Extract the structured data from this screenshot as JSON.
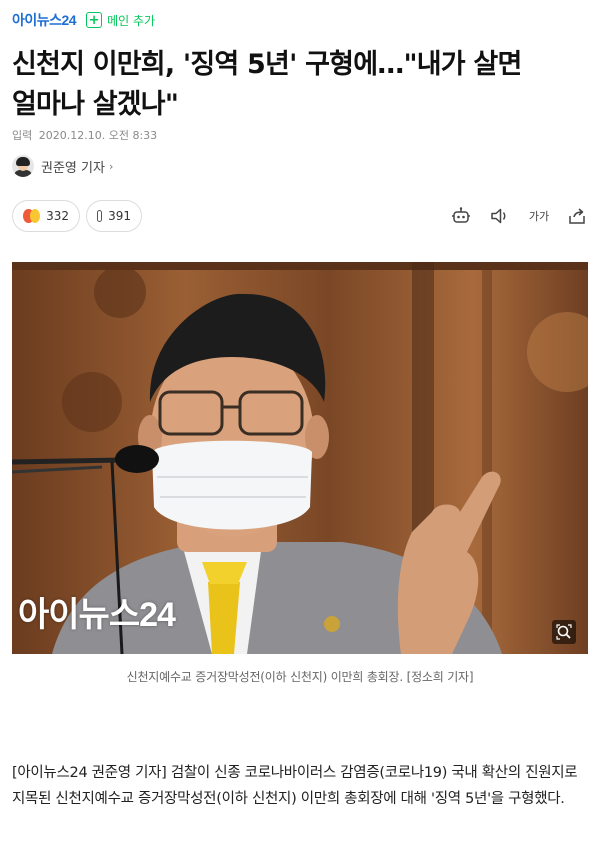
{
  "header": {
    "press_name": "아이뉴스24",
    "plus_symbol": "+",
    "main_add_label": "메인 추가"
  },
  "article": {
    "headline": "신천지 이만희, '징역 5년' 구형에…\"내가 살면 얼마나 살겠나\"",
    "date_label": "입력",
    "date_value": "2020.12.10. 오전 8:33",
    "reporter": "권준영 기자",
    "reporter_chevron": "›"
  },
  "reactions": {
    "reaction_count": "332",
    "comment_count": "391"
  },
  "tools": {
    "font_size_label": "가가"
  },
  "photo": {
    "watermark": "아이뉴스24",
    "caption": "신천지예수교 증거장막성전(이하 신천지) 이만희 총회장. [정소희 기자]"
  },
  "body": {
    "lead": "[아이뉴스24 권준영 기자] 검찰이 신종 코로나바이러스 감염증(코로나19) 국내 확산의 진원지로 지목된 신천지예수교 증거장막성전(이하 신천지) 이만희 총회장에 대해 '징역 5년'을 구형했다."
  },
  "colors": {
    "press_blue": "#1e6ed6",
    "naver_green": "#03c75a",
    "angry_emoji": "#f05a3a",
    "happy_emoji": "#f9c633"
  },
  "icons": [
    "plus-icon",
    "avatar-icon",
    "angry-emoji-icon",
    "happy-emoji-icon",
    "comment-icon",
    "robot-icon",
    "speaker-icon",
    "font-size-icon",
    "share-icon",
    "zoom-icon"
  ]
}
